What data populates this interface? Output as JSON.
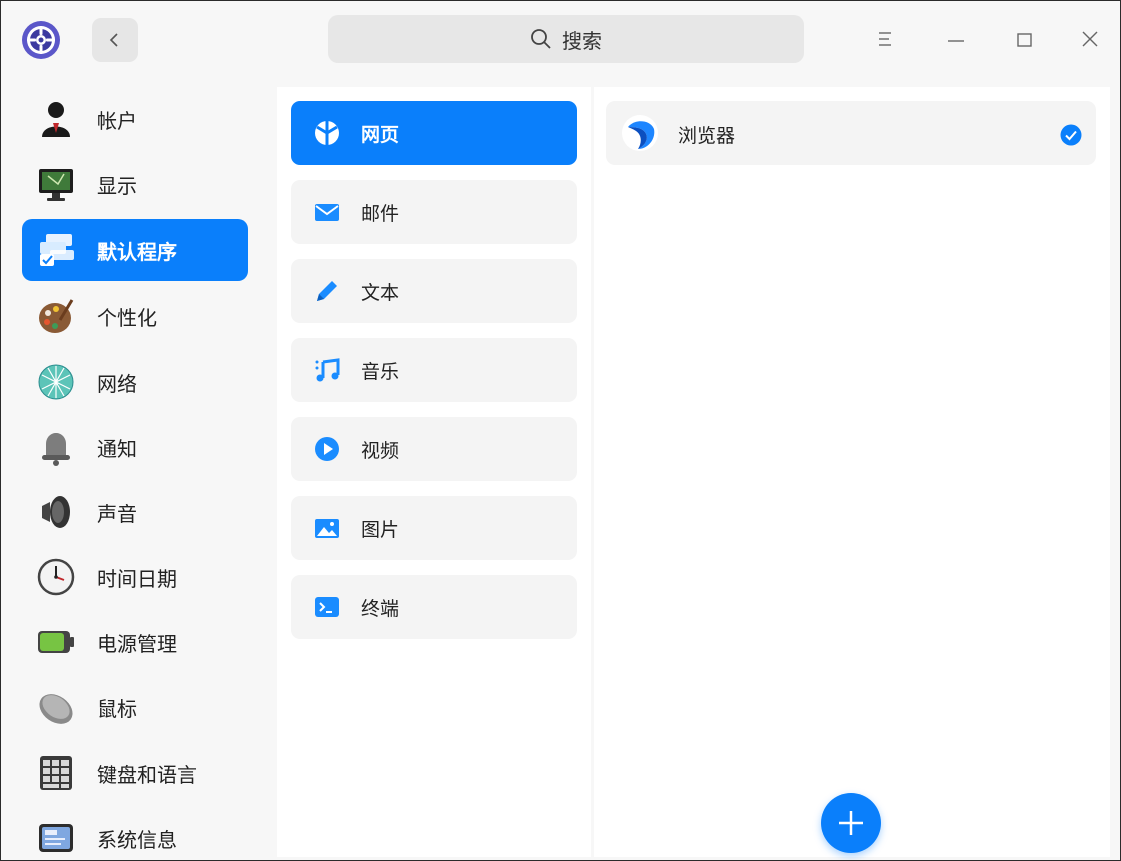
{
  "window": {
    "search_placeholder": "搜索"
  },
  "sidebar": {
    "items": [
      {
        "label": "帐户",
        "icon": "user-account-icon"
      },
      {
        "label": "显示",
        "icon": "monitor-icon"
      },
      {
        "label": "默认程序",
        "icon": "default-apps-icon",
        "active": true
      },
      {
        "label": "个性化",
        "icon": "palette-icon"
      },
      {
        "label": "网络",
        "icon": "network-globe-icon"
      },
      {
        "label": "通知",
        "icon": "bell-icon"
      },
      {
        "label": "声音",
        "icon": "speaker-icon"
      },
      {
        "label": "时间日期",
        "icon": "clock-icon"
      },
      {
        "label": "电源管理",
        "icon": "battery-icon"
      },
      {
        "label": "鼠标",
        "icon": "mouse-icon"
      },
      {
        "label": "键盘和语言",
        "icon": "keyboard-icon"
      },
      {
        "label": "系统信息",
        "icon": "system-info-icon"
      }
    ]
  },
  "categories": {
    "items": [
      {
        "label": "网页",
        "icon": "web-icon",
        "active": true
      },
      {
        "label": "邮件",
        "icon": "mail-icon"
      },
      {
        "label": "文本",
        "icon": "pencil-icon"
      },
      {
        "label": "音乐",
        "icon": "music-icon"
      },
      {
        "label": "视频",
        "icon": "video-play-icon"
      },
      {
        "label": "图片",
        "icon": "image-icon"
      },
      {
        "label": "终端",
        "icon": "terminal-icon"
      }
    ]
  },
  "apps": {
    "items": [
      {
        "label": "浏览器",
        "icon": "browser-icon",
        "selected": true
      }
    ]
  },
  "colors": {
    "accent": "#0a7ffb",
    "panel": "#f4f4f4",
    "background": "#f7f7f7"
  }
}
